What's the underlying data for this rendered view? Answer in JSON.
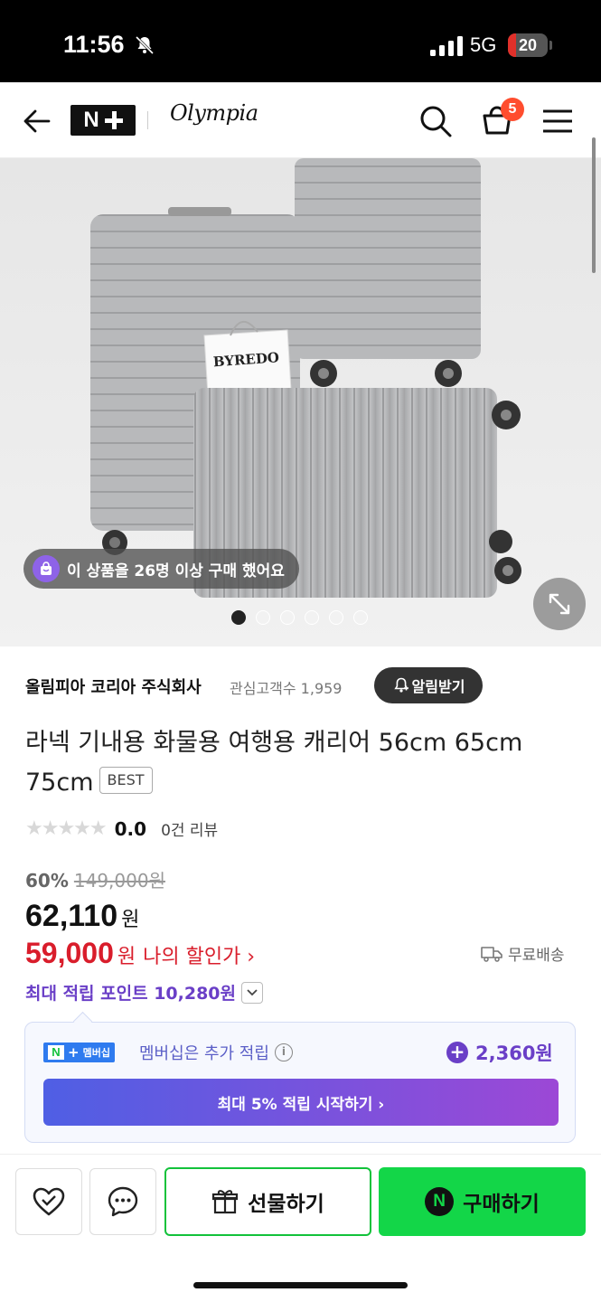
{
  "status_bar": {
    "time": "11:56",
    "network": "5G",
    "battery": "20",
    "battery_level": 0.2
  },
  "header": {
    "store_logo_text": "N",
    "brand_name": "Olympia",
    "cart_count": "5"
  },
  "hero": {
    "purchase_notice": "이 상품을 26명 이상 구매 했어요",
    "image_count": 6,
    "active_image_index": 0,
    "colors": {
      "photo_bg": "#ececec",
      "suitcase": "#b9babc"
    }
  },
  "seller": {
    "name": "올림피아 코리아 주식회사",
    "fans_label": "관심고객수 1,959",
    "alert_label": "알림받기"
  },
  "product": {
    "title": "라넥 기내용 화물용 여행용 캐리어 56cm 65cm 75cm",
    "badge": "BEST",
    "rating": "0.0",
    "review_count": "0건 리뷰",
    "rating_stars": 0
  },
  "price": {
    "discount_rate": "60%",
    "original_price": "149,000원",
    "sale_price": "62,110",
    "sale_unit": "원",
    "my_price": "59,000",
    "my_price_unit": "원",
    "my_price_label": "나의 할인가 ›",
    "shipping": "무료배송",
    "max_points": "최대 적립 포인트 10,280원"
  },
  "membership": {
    "logo_label": "멤버십",
    "text": "멤버십은 추가 적립",
    "extra_points": "2,360원",
    "cta": "최대 5% 적립 시작하기 ›",
    "colors": {
      "accent": "#6a3fc7",
      "gradient_start": "#4f5fe4",
      "gradient_end": "#9c48d6"
    }
  },
  "bottom_bar": {
    "gift_label": "선물하기",
    "buy_label": "구매하기",
    "colors": {
      "green": "#13d648"
    }
  },
  "icons": {
    "back": "back-arrow-icon",
    "search": "search-icon",
    "cart": "cart-icon",
    "menu": "hamburger-menu-icon",
    "wishlist": "heart-icon",
    "chat": "chat-bubble-icon",
    "gift": "gift-icon",
    "zoom": "expand-icon",
    "bell": "bell-icon",
    "truck": "truck-icon"
  }
}
